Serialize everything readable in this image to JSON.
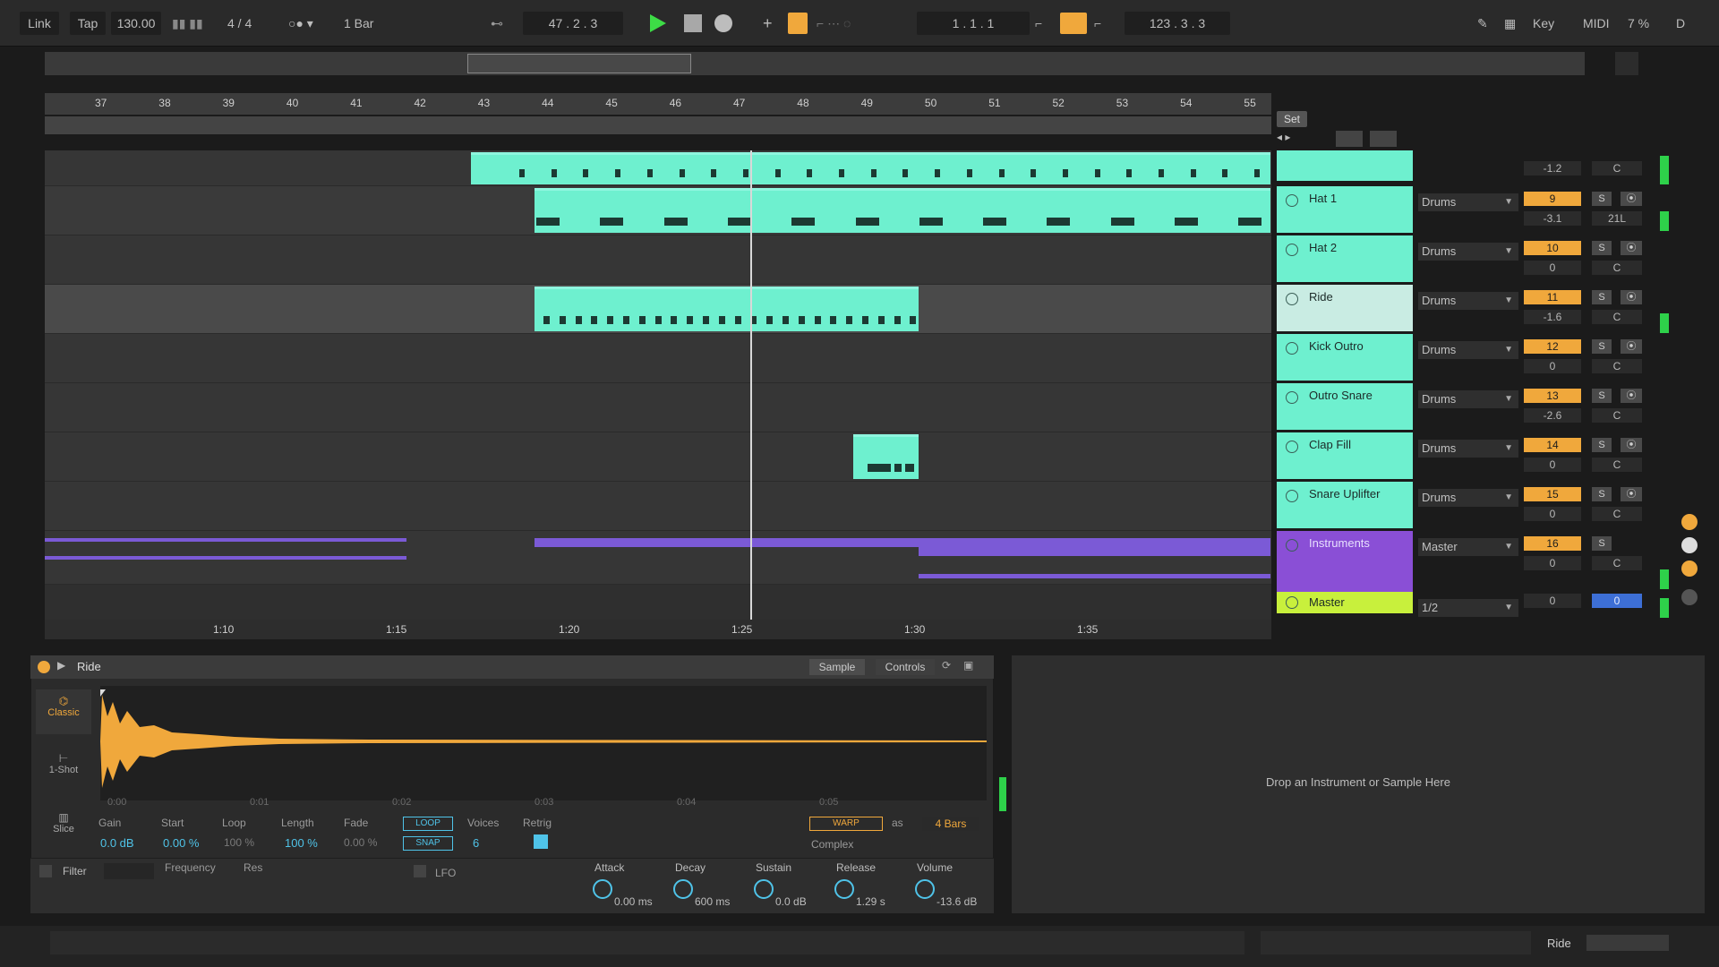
{
  "topbar": {
    "link": "Link",
    "tap": "Tap",
    "tempo": "130.00",
    "signature": "4 / 4",
    "quantize": "1 Bar",
    "position": "47 . 2 . 3",
    "loop_start": "1 . 1 . 1",
    "loop_length": "123 . 3 . 3",
    "key": "Key",
    "midi": "MIDI",
    "cpu": "7 %",
    "d": "D"
  },
  "ruler": {
    "bars": [
      "37",
      "38",
      "39",
      "40",
      "41",
      "42",
      "43",
      "44",
      "45",
      "46",
      "47",
      "48",
      "49",
      "50",
      "51",
      "52",
      "53",
      "54",
      "55"
    ]
  },
  "timeline": {
    "times": [
      "1:10",
      "1:15",
      "1:20",
      "1:25",
      "1:30",
      "1:35"
    ]
  },
  "set_label": "Set",
  "tracks": [
    {
      "name": "",
      "route": "",
      "num": "",
      "vol": "-1.2",
      "pan": "C"
    },
    {
      "name": "Hat 1",
      "route": "Drums",
      "num": "9",
      "vol": "-3.1",
      "pan": "21L"
    },
    {
      "name": "Hat 2",
      "route": "Drums",
      "num": "10",
      "vol": "0",
      "pan": "C"
    },
    {
      "name": "Ride",
      "route": "Drums",
      "num": "11",
      "vol": "-1.6",
      "pan": "C"
    },
    {
      "name": "Kick Outro",
      "route": "Drums",
      "num": "12",
      "vol": "0",
      "pan": "C"
    },
    {
      "name": "Outro Snare",
      "route": "Drums",
      "num": "13",
      "vol": "-2.6",
      "pan": "C"
    },
    {
      "name": "Clap Fill",
      "route": "Drums",
      "num": "14",
      "vol": "0",
      "pan": "C"
    },
    {
      "name": "Snare Uplifter",
      "route": "Drums",
      "num": "15",
      "vol": "0",
      "pan": "C"
    },
    {
      "name": "Instruments",
      "route": "Master",
      "num": "16",
      "vol": "0",
      "pan": "C"
    },
    {
      "name": "Master",
      "route": "1/2",
      "num": "",
      "vol": "0",
      "pan": "0"
    }
  ],
  "track_buttons": {
    "solo": "S"
  },
  "device": {
    "title": "Ride",
    "tab_sample": "Sample",
    "tab_controls": "Controls",
    "modes": [
      "Classic",
      "1-Shot",
      "Slice"
    ],
    "wave_ticks": [
      "0:00",
      "0:01",
      "0:02",
      "0:03",
      "0:04",
      "0:05"
    ],
    "params": {
      "gain_label": "Gain",
      "gain": "0.0 dB",
      "start_label": "Start",
      "start": "0.00 %",
      "loop_label": "Loop",
      "loop": "100 %",
      "length_label": "Length",
      "length": "100 %",
      "fade_label": "Fade",
      "fade": "0.00 %",
      "loop_btn": "LOOP",
      "snap_btn": "SNAP",
      "voices_label": "Voices",
      "voices": "6",
      "retrig_label": "Retrig",
      "warp_btn": "WARP",
      "as": "as",
      "bars": "4 Bars",
      "warp_mode": "Complex"
    },
    "filter_label": "Filter",
    "frequency_label": "Frequency",
    "res_label": "Res",
    "lfo_label": "LFO",
    "env": [
      {
        "label": "Attack",
        "value": "0.00 ms"
      },
      {
        "label": "Decay",
        "value": "600 ms"
      },
      {
        "label": "Sustain",
        "value": "0.0 dB"
      },
      {
        "label": "Release",
        "value": "1.29 s"
      },
      {
        "label": "Volume",
        "value": "-13.6 dB"
      }
    ]
  },
  "drop_area": "Drop an Instrument or Sample Here",
  "statusbar": {
    "track": "Ride"
  },
  "colors": {
    "clip": "#6ef0cf",
    "accent": "#f0a83c",
    "midi": "#7b5ad6",
    "master": "#c8f03c",
    "play": "#3ddc46"
  }
}
